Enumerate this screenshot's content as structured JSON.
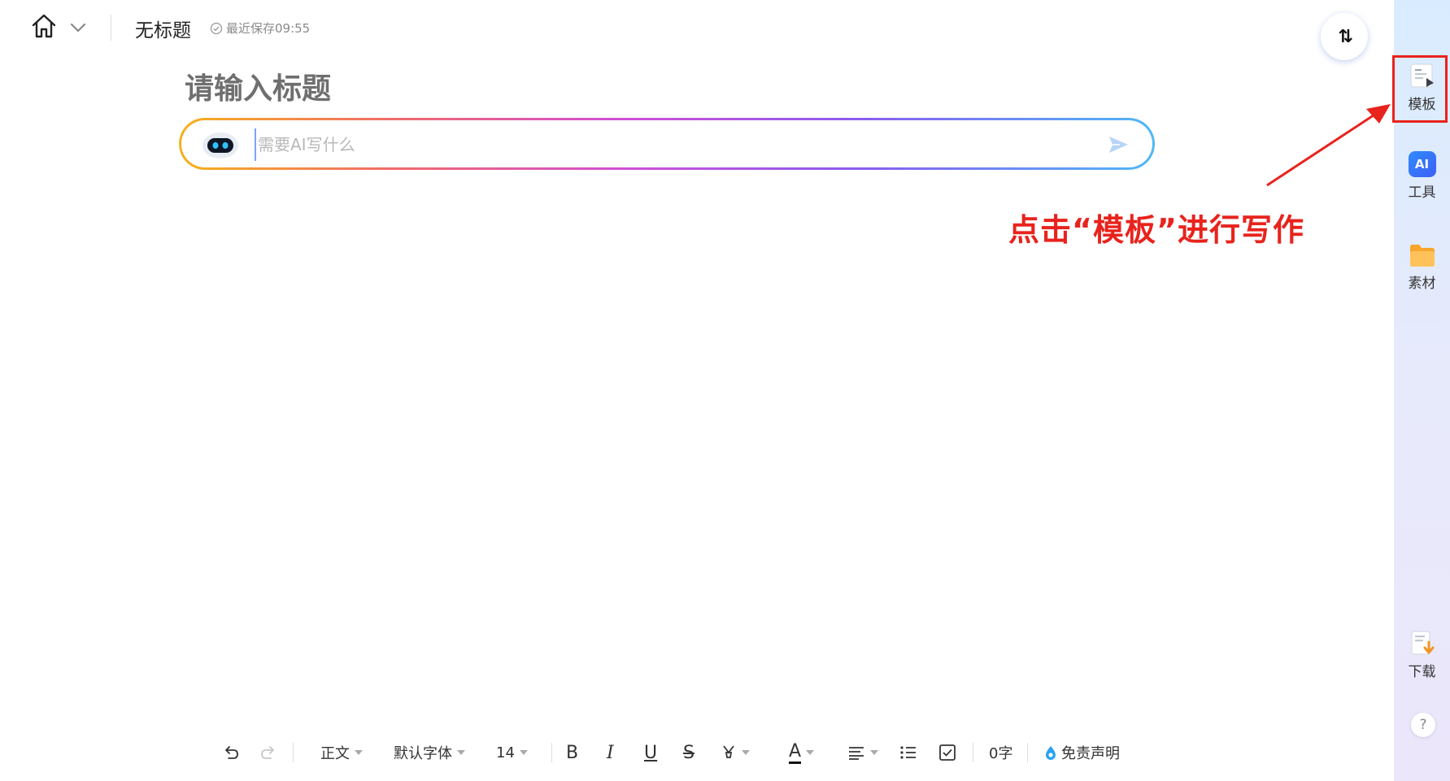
{
  "header": {
    "home_icon": "home-icon",
    "chevron_icon": "chevron-down-icon",
    "doc_title": "无标题",
    "save_status": "最近保存09:55",
    "collapse_icon": "swap-vertical-icon",
    "collapse_glyph": "⇅"
  },
  "editor": {
    "title_placeholder": "请输入标题",
    "ai_placeholder": "需要AI写什么",
    "ai_input_value": "",
    "gradient_colors": [
      "#f5b21c",
      "#f26a6a",
      "#d14ed4",
      "#8a5cf0",
      "#4fb8f7"
    ]
  },
  "annotation": {
    "text": "点击“模板”进行写作",
    "color": "#e8231d"
  },
  "sidebar": {
    "items": [
      {
        "label": "模板",
        "icon": "template-icon"
      },
      {
        "label": "工具",
        "icon": "ai-tool-icon",
        "badge": "AI"
      },
      {
        "label": "素材",
        "icon": "folder-icon"
      },
      {
        "label": "下载",
        "icon": "download-icon"
      }
    ],
    "help": "?"
  },
  "toolbar": {
    "undo_icon": "undo-icon",
    "redo_icon": "redo-icon",
    "paragraph_style": "正文",
    "font_family": "默认字体",
    "font_size": "14",
    "bold": "B",
    "italic": "I",
    "underline": "U",
    "strikethrough": "S",
    "highlight_icon": "highlighter-icon",
    "font_color": "A",
    "align_icon": "align-left-icon",
    "list_icon": "bullet-list-icon",
    "checkbox_icon": "checkbox-icon",
    "word_count": "0字",
    "disclaimer": "免责声明"
  }
}
